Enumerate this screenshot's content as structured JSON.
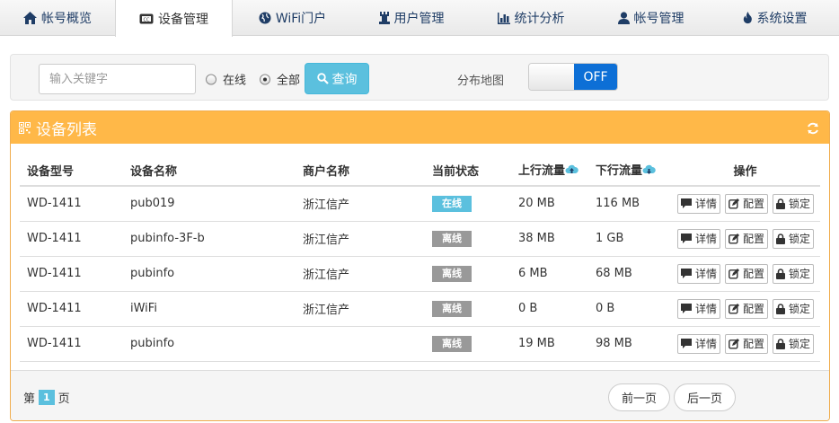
{
  "nav": {
    "tabs": [
      {
        "label": "帐号概览",
        "icon": "home-icon"
      },
      {
        "label": "设备管理",
        "icon": "device-icon"
      },
      {
        "label": "WiFi门户",
        "icon": "globe-icon"
      },
      {
        "label": "用户管理",
        "icon": "user-manage-icon"
      },
      {
        "label": "统计分析",
        "icon": "bar-chart-icon"
      },
      {
        "label": "帐号管理",
        "icon": "user-icon"
      },
      {
        "label": "系统设置",
        "icon": "fire-icon"
      }
    ],
    "active": "设备管理"
  },
  "search": {
    "placeholder": "输入关键字",
    "radio_online": "在线",
    "radio_all": "全部",
    "selected": "全部",
    "query_label": "查询",
    "map_label": "分布地图",
    "toggle_value": "OFF"
  },
  "panel": {
    "title": "设备列表",
    "columns": [
      "设备型号",
      "设备名称",
      "商户名称",
      "当前状态",
      "上行流量",
      "下行流量",
      "操作"
    ],
    "rows": [
      {
        "model": "WD-1411",
        "name": "pub019",
        "merchant": "浙江信产",
        "status": "在线",
        "up": "20 MB",
        "down": "116 MB"
      },
      {
        "model": "WD-1411",
        "name": "pubinfo-3F-b",
        "merchant": "浙江信产",
        "status": "离线",
        "up": "38 MB",
        "down": "1 GB"
      },
      {
        "model": "WD-1411",
        "name": "pubinfo",
        "merchant": "浙江信产",
        "status": "离线",
        "up": "6 MB",
        "down": "68 MB"
      },
      {
        "model": "WD-1411",
        "name": "iWiFi",
        "merchant": "浙江信产",
        "status": "离线",
        "up": "0 B",
        "down": "0 B"
      },
      {
        "model": "WD-1411",
        "name": "pubinfo",
        "merchant": "",
        "status": "离线",
        "up": "19 MB",
        "down": "98 MB"
      }
    ],
    "actions": {
      "detail": "详情",
      "config": "配置",
      "lock": "锁定"
    }
  },
  "pagination": {
    "prefix": "第",
    "page": "1",
    "suffix": "页",
    "prev": "前一页",
    "next": "后一页"
  },
  "colors": {
    "nav_text": "#1f3d66",
    "panel_header": "#ffb848",
    "online_badge": "#5bc0de",
    "offline_badge": "#999999",
    "toggle_off": "#0d6fd6",
    "query_button": "#5bc0de"
  }
}
